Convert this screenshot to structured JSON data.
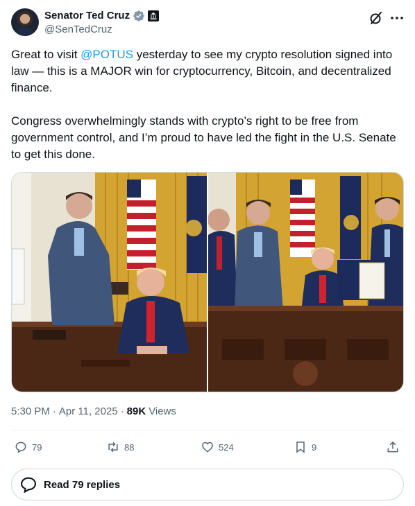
{
  "author": {
    "display_name": "Senator Ted Cruz",
    "handle": "@SenTedCruz",
    "verified_color": "#829aab"
  },
  "tweet": {
    "text_before_mention": "Great to visit ",
    "mention": "@POTUS",
    "text_after_mention": " yesterday to see my crypto resolution signed into law — this is a MAJOR win for cryptocurrency, Bitcoin, and decentralized finance.\n\nCongress overwhelmingly stands with crypto’s right to be free from government control, and I’m proud to have led the fight in the U.S. Senate to get this done."
  },
  "meta": {
    "time": "5:30 PM",
    "sep1": "·",
    "date": "Apr 11, 2025",
    "sep2": "·",
    "views_count": "89K",
    "views_label": "Views"
  },
  "actions": {
    "replies": "79",
    "reposts": "88",
    "likes": "524",
    "bookmarks": "9"
  },
  "read_replies_label": "Read 79 replies",
  "colors": {
    "accent": "#1d9bf0",
    "secondary_text": "#536471",
    "border": "#cfd9de"
  }
}
